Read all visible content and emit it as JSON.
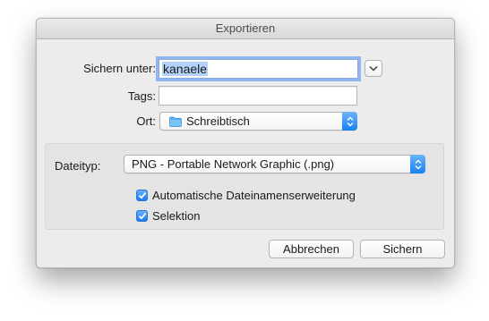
{
  "dialog": {
    "title": "Exportieren",
    "save_as_label": "Sichern unter:",
    "save_as_value": "kanaele",
    "tags_label": "Tags:",
    "tags_value": "",
    "location_label": "Ort:",
    "location_value": "Schreibtisch",
    "format_label": "Dateityp:",
    "format_value": "PNG - Portable Network Graphic (.png)",
    "options": [
      {
        "label": "Automatische Dateinamenserweiterung",
        "checked": true
      },
      {
        "label": "Selektion",
        "checked": true
      }
    ],
    "cancel_label": "Abbrechen",
    "save_label": "Sichern"
  },
  "colors": {
    "accent": "#1a7ef0",
    "selection": "#b3d3fd",
    "folder": "#5ab0f0"
  },
  "icons": {
    "expand": "chevron-down-icon",
    "location": "folder-icon",
    "popup": "updown-arrows-icon",
    "check": "checkmark-icon"
  }
}
